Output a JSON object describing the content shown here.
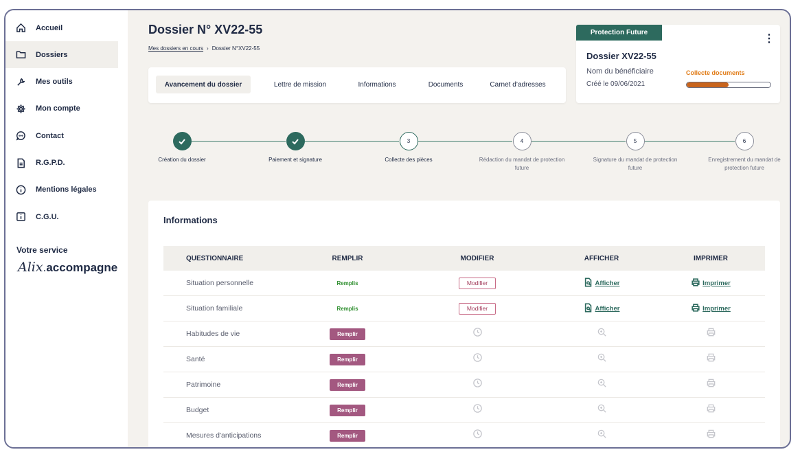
{
  "sidebar": {
    "items": [
      {
        "label": "Accueil",
        "icon": "home-icon",
        "active": false
      },
      {
        "label": "Dossiers",
        "icon": "folder-icon",
        "active": true
      },
      {
        "label": "Mes outils",
        "icon": "wrench-icon",
        "active": false
      },
      {
        "label": "Mon compte",
        "icon": "gear-icon",
        "active": false
      },
      {
        "label": "Contact",
        "icon": "chat-icon",
        "active": false
      },
      {
        "label": "R.G.P.D.",
        "icon": "document-icon",
        "active": false
      },
      {
        "label": "Mentions légales",
        "icon": "info-circle-icon",
        "active": false
      },
      {
        "label": "C.G.U.",
        "icon": "info-square-icon",
        "active": false
      }
    ],
    "service_label": "Votre service",
    "brand_script": "Alix",
    "brand_bold": "accompagne"
  },
  "header": {
    "title": "Dossier N° XV22-55",
    "breadcrumb": {
      "link": "Mes dossiers en cours",
      "separator": "›",
      "current": "Dossier N°XV22-55"
    }
  },
  "tabs": [
    {
      "label": "Avancement du dossier",
      "active": true
    },
    {
      "label": "Lettre de mission",
      "active": false
    },
    {
      "label": "Informations",
      "active": false
    },
    {
      "label": "Documents",
      "active": false
    },
    {
      "label": "Carnet d’adresses",
      "active": false
    }
  ],
  "dossier_card": {
    "badge": "Protection Future",
    "menu_icon": "⋮",
    "title": "Dossier XV22-55",
    "beneficiary": "Nom du bénéficiaire",
    "created": "Créé le 09/06/2021",
    "status": "Collecte documents",
    "progress": 0.5,
    "status_color": "#e07b16",
    "progress_color": "#c8641c"
  },
  "steps": [
    {
      "number": "1",
      "label": "Création du dossier",
      "state": "done"
    },
    {
      "number": "2",
      "label": "Paiement et signature",
      "state": "done"
    },
    {
      "number": "3",
      "label": "Collecte des pièces",
      "state": "current"
    },
    {
      "number": "4",
      "label": "Rédaction du mandat de protection future",
      "state": "todo"
    },
    {
      "number": "5",
      "label": "Signature du mandat de protection future",
      "state": "todo"
    },
    {
      "number": "6",
      "label": "Enregistrement du mandat de protection future",
      "state": "todo"
    }
  ],
  "info": {
    "title": "Informations",
    "columns": [
      "QUESTIONNAIRE",
      "REMPLIR",
      "MODIFIER",
      "AFFICHER",
      "IMPRIMER"
    ],
    "rows": [
      {
        "name": "Situation personnelle",
        "filled": true,
        "status": "Remplis",
        "modify": "Modifier",
        "show": "Afficher",
        "print": "Imprimer"
      },
      {
        "name": "Situation familiale",
        "filled": true,
        "status": "Remplis",
        "modify": "Modifier",
        "show": "Afficher",
        "print": "Imprimer"
      },
      {
        "name": "Habitudes de vie",
        "filled": false,
        "action": "Remplir"
      },
      {
        "name": "Santé",
        "filled": false,
        "action": "Remplir"
      },
      {
        "name": "Patrimoine",
        "filled": false,
        "action": "Remplir"
      },
      {
        "name": "Budget",
        "filled": false,
        "action": "Remplir"
      },
      {
        "name": "Mesures d'anticipations",
        "filled": false,
        "action": "Remplir"
      }
    ]
  },
  "colors": {
    "primary": "#2d6a5e",
    "accent": "#a35880",
    "navy": "#1f2a44"
  }
}
